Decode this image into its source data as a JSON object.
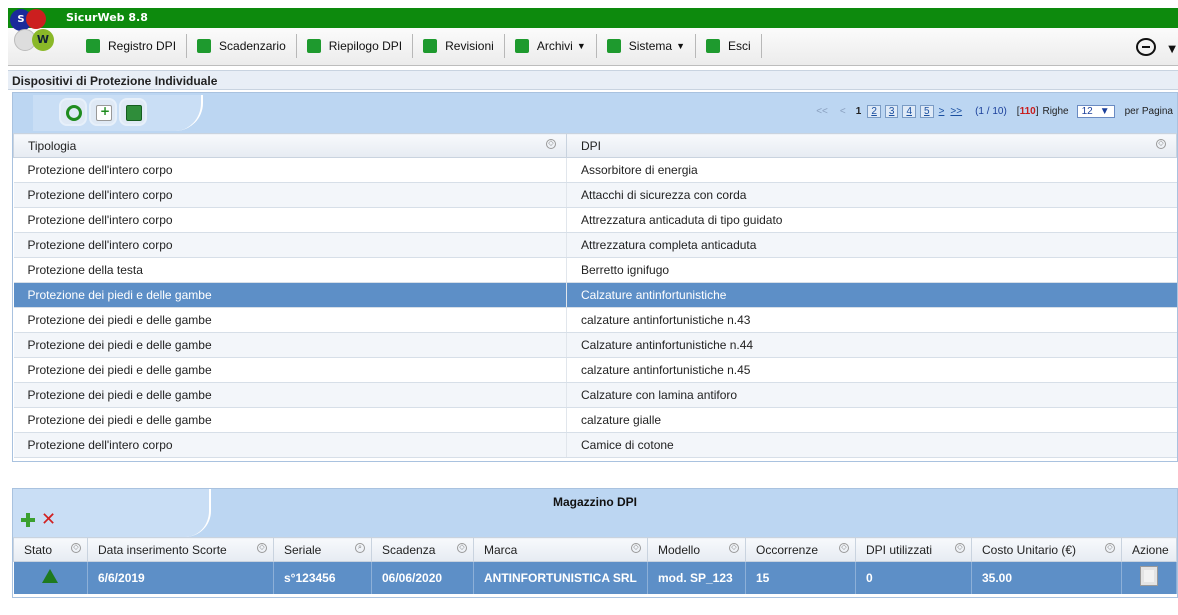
{
  "app": {
    "title": "SicurWeb 8.8",
    "logo_letters": [
      "S",
      "W"
    ]
  },
  "menu": [
    {
      "label": "Registro DPI",
      "icon": "clipboard-icon"
    },
    {
      "label": "Scadenzario",
      "icon": "calendar-icon"
    },
    {
      "label": "Riepilogo DPI",
      "icon": "chart-icon"
    },
    {
      "label": "Revisioni",
      "icon": "pencil-icon"
    },
    {
      "label": "Archivi",
      "icon": "archive-icon",
      "dropdown": true
    },
    {
      "label": "Sistema",
      "icon": "wrench-icon",
      "dropdown": true
    },
    {
      "label": "Esci",
      "icon": "power-icon"
    }
  ],
  "section": {
    "title": "Dispositivi di Protezione Individuale"
  },
  "pager": {
    "first": "<<",
    "prev": "<",
    "current": "1",
    "pages": [
      "2",
      "3",
      "4",
      "5"
    ],
    "next": ">",
    "last": ">>",
    "info": "(1 / 10)",
    "total": "110",
    "righe_label": "Righe",
    "per_page": "12",
    "per_page_label": "per Pagina"
  },
  "table": {
    "columns": [
      "Tipologia",
      "DPI"
    ],
    "rows": [
      [
        "Protezione dell'intero corpo",
        "Assorbitore di energia"
      ],
      [
        "Protezione dell'intero corpo",
        "Attacchi di sicurezza con corda"
      ],
      [
        "Protezione dell'intero corpo",
        "Attrezzatura anticaduta di tipo guidato"
      ],
      [
        "Protezione dell'intero corpo",
        "Attrezzatura completa anticaduta"
      ],
      [
        "Protezione della testa",
        "Berretto ignifugo"
      ],
      [
        "Protezione dei piedi e delle gambe",
        "Calzature antinfortunistiche"
      ],
      [
        "Protezione dei piedi e delle gambe",
        "calzature antinfortunistiche n.43"
      ],
      [
        "Protezione dei piedi e delle gambe",
        "Calzature antinfortunistiche n.44"
      ],
      [
        "Protezione dei piedi e delle gambe",
        "calzature antinfortunistiche n.45"
      ],
      [
        "Protezione dei piedi e delle gambe",
        "Calzature con lamina antiforo"
      ],
      [
        "Protezione dei piedi e delle gambe",
        "calzature gialle"
      ],
      [
        "Protezione dell'intero corpo",
        "Camice di cotone"
      ]
    ],
    "selected_index": 5
  },
  "magazzino": {
    "title": "Magazzino DPI",
    "columns": [
      "Stato",
      "Data inserimento Scorte",
      "Seriale",
      "Scadenza",
      "Marca",
      "Modello",
      "Occorrenze",
      "DPI utilizzati",
      "Costo Unitario (€)",
      "Azione"
    ],
    "row": {
      "stato_icon": "tree-icon",
      "data": "6/6/2019",
      "seriale": "s°123456",
      "scadenza": "06/06/2020",
      "marca": "ANTINFORTUNISTICA SRL",
      "modello": "mod. SP_123",
      "occorrenze": "15",
      "utilizzati": "0",
      "costo": "35.00",
      "azione_icon": "document-icon"
    }
  },
  "colors": {
    "title_bar": "#0d8a0d",
    "selection": "#5d8fc7",
    "toolbar": "#bcd6f2",
    "total_highlight": "#c81d1d"
  }
}
